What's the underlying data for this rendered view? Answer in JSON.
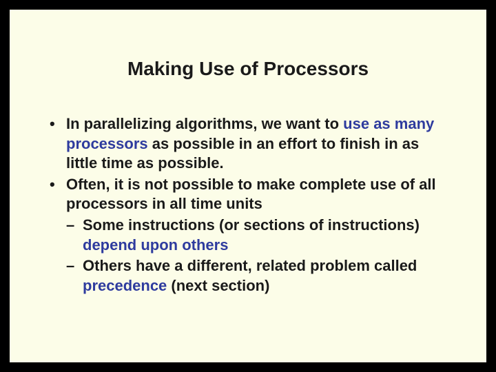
{
  "title": "Making Use of Processors",
  "bullet1_pre": "In parallelizing algorithms, we want to ",
  "bullet1_hl": "use as many processors",
  "bullet1_post": " as possible in an effort to finish in as little time as possible.",
  "bullet2": "Often, it is not possible to make complete use of all processors in all time units",
  "sub1_pre": "Some instructions (or sections of instructions) ",
  "sub1_hl": "depend upon others",
  "sub2_pre": "Others have a different, related problem called ",
  "sub2_hl": "precedence",
  "sub2_post": " (next section)"
}
